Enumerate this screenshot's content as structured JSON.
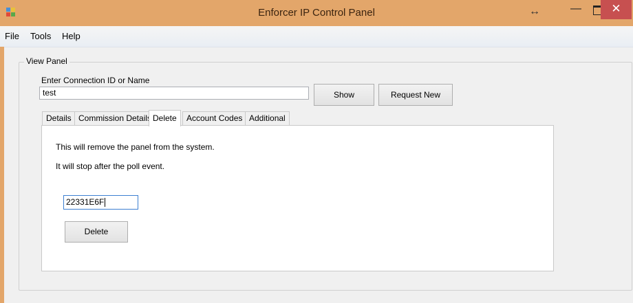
{
  "window": {
    "title": "Enforcer IP Control Panel",
    "controls": {
      "resize": "↔",
      "minimize": "—",
      "close": "✕"
    },
    "colors": {
      "titlebar": "#e3a66a",
      "close": "#c75050"
    },
    "app_icon": "app-grid-icon"
  },
  "menu": {
    "items": [
      "File",
      "Tools",
      "Help"
    ]
  },
  "view_panel": {
    "group_label": "View Panel",
    "connection_label": "Enter Connection ID or Name",
    "connection_value": "test",
    "show_button": "Show",
    "request_button": "Request New"
  },
  "tabs": {
    "items": [
      "Details",
      "Commission Details",
      "Delete",
      "Account Codes",
      "Additional"
    ],
    "active": "Delete"
  },
  "delete_tab": {
    "line1": "This will remove the panel from the system.",
    "line2": "It will stop after the poll event.",
    "id_value": "22331E6F",
    "delete_button": "Delete"
  }
}
